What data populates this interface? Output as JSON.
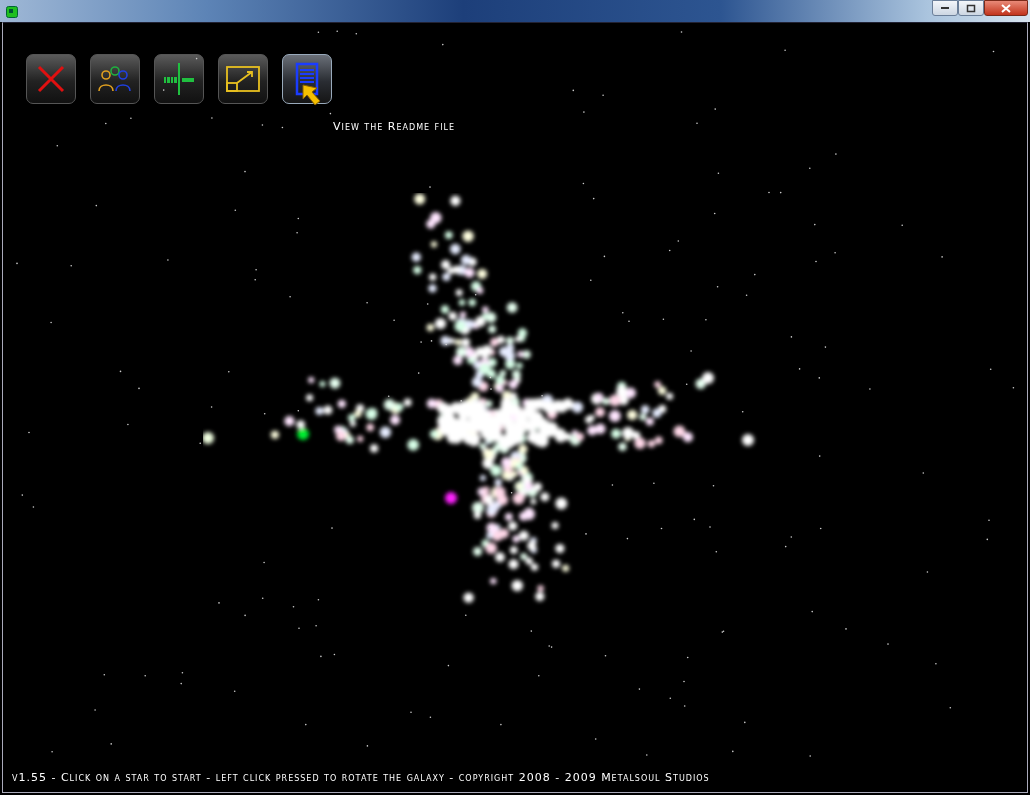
{
  "toolbar": [
    {
      "kind": "exit",
      "hovered": false
    },
    {
      "kind": "players",
      "hovered": false
    },
    {
      "kind": "codes",
      "hovered": false
    },
    {
      "kind": "resize",
      "hovered": false
    },
    {
      "kind": "readme",
      "hovered": true
    }
  ],
  "tooltip": "View the Readme file",
  "status_bar": "v1.55 - Click on a star to start - left click pressed to rotate the galaxy - copyright 2008 - 2009 Metalsoul Studios"
}
